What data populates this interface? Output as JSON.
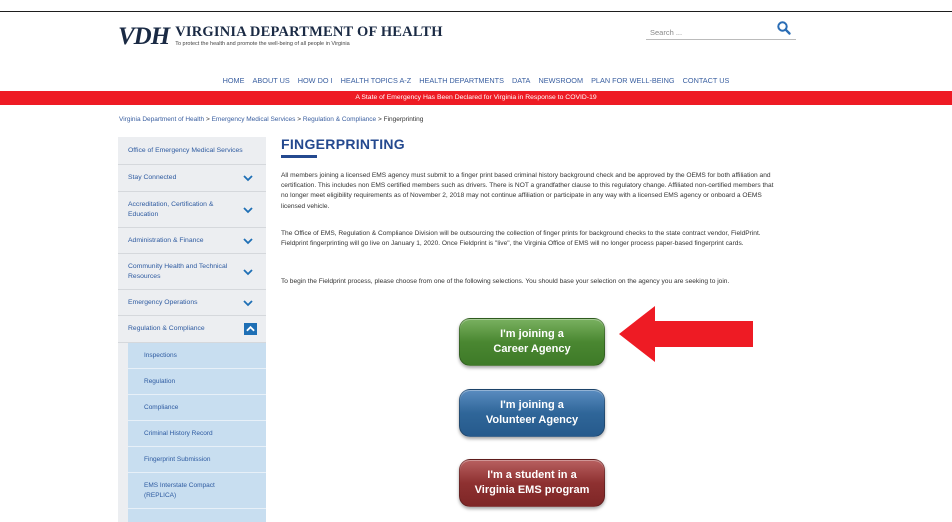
{
  "header": {
    "logo_mark": "VDH",
    "logo_name": "VIRGINIA DEPARTMENT OF HEALTH",
    "logo_tagline": "To protect the health and promote the well-being of all people in Virginia",
    "search_placeholder": "Search ..."
  },
  "nav": {
    "items": [
      "HOME",
      "ABOUT US",
      "HOW DO I",
      "HEALTH TOPICS A-Z",
      "HEALTH DEPARTMENTS",
      "DATA",
      "NEWSROOM",
      "PLAN FOR WELL-BEING",
      "CONTACT US"
    ]
  },
  "banner": {
    "text": "A State of Emergency Has Been Declared for Virginia in Response to COVID-19"
  },
  "breadcrumb": {
    "items": [
      "Virginia Department of Health",
      "Emergency Medical Services",
      "Regulation & Compliance"
    ],
    "current": "Fingerprinting",
    "separator": ">"
  },
  "sidebar": {
    "items": [
      {
        "label": "Office of Emergency Medical Services"
      },
      {
        "label": "Stay Connected"
      },
      {
        "label": "Accreditation, Certification & Education"
      },
      {
        "label": "Administration & Finance"
      },
      {
        "label": "Community Health and Technical Resources"
      },
      {
        "label": "Emergency Operations"
      },
      {
        "label": "Regulation & Compliance"
      }
    ],
    "subitems": [
      {
        "label": "Inspections"
      },
      {
        "label": "Regulation"
      },
      {
        "label": "Compliance"
      },
      {
        "label": "Criminal History Record"
      },
      {
        "label": "Fingerprint Submission"
      },
      {
        "label": "EMS Interstate Compact (REPLICA)"
      }
    ]
  },
  "main": {
    "title": "FINGERPRINTING",
    "paragraphs": [
      "All members joining a licensed EMS agency must submit to a finger print based criminal history background check and be approved by the OEMS for both affiliation and certification. This includes non EMS certified members such as drivers. There is NOT a grandfather clause to this regulatory change. Affiliated non-certified members that no longer meet eligibility requirements as of November 2, 2018 may not continue affiliation or participate in any way with a licensed EMS agency or onboard a OEMS licensed vehicle.",
      "The Office of EMS, Regulation & Compliance Division will be outsourcing the collection of finger prints for background checks to the state contract vendor, FieldPrint. Fieldprint fingerprinting will go live on January 1, 2020. Once Fieldprint is \"live\", the Virginia Office of EMS will no longer process paper-based fingerprint cards.",
      "To begin the Fieldprint process, please choose from one of the following selections. You should base your selection on the agency you are seeking to join."
    ],
    "buttons": [
      {
        "line1": "I'm joining a",
        "line2": "Career Agency"
      },
      {
        "line1": "I'm joining a",
        "line2": "Volunteer Agency"
      },
      {
        "line1": "I'm a student in a",
        "line2": "Virginia EMS program"
      }
    ]
  },
  "colors": {
    "banner": "#ee1b24",
    "arrow": "#ee1b24",
    "link": "#3a5fa0",
    "title": "#24498f",
    "btn_green": "#4a8731",
    "btn_blue": "#2f6699",
    "btn_red": "#8e3131"
  },
  "icons": {
    "search": "magnifier-icon",
    "chevron": "chevron-down-icon",
    "chevron_active": "chevron-up-icon",
    "annotation": "arrow-left-icon"
  }
}
